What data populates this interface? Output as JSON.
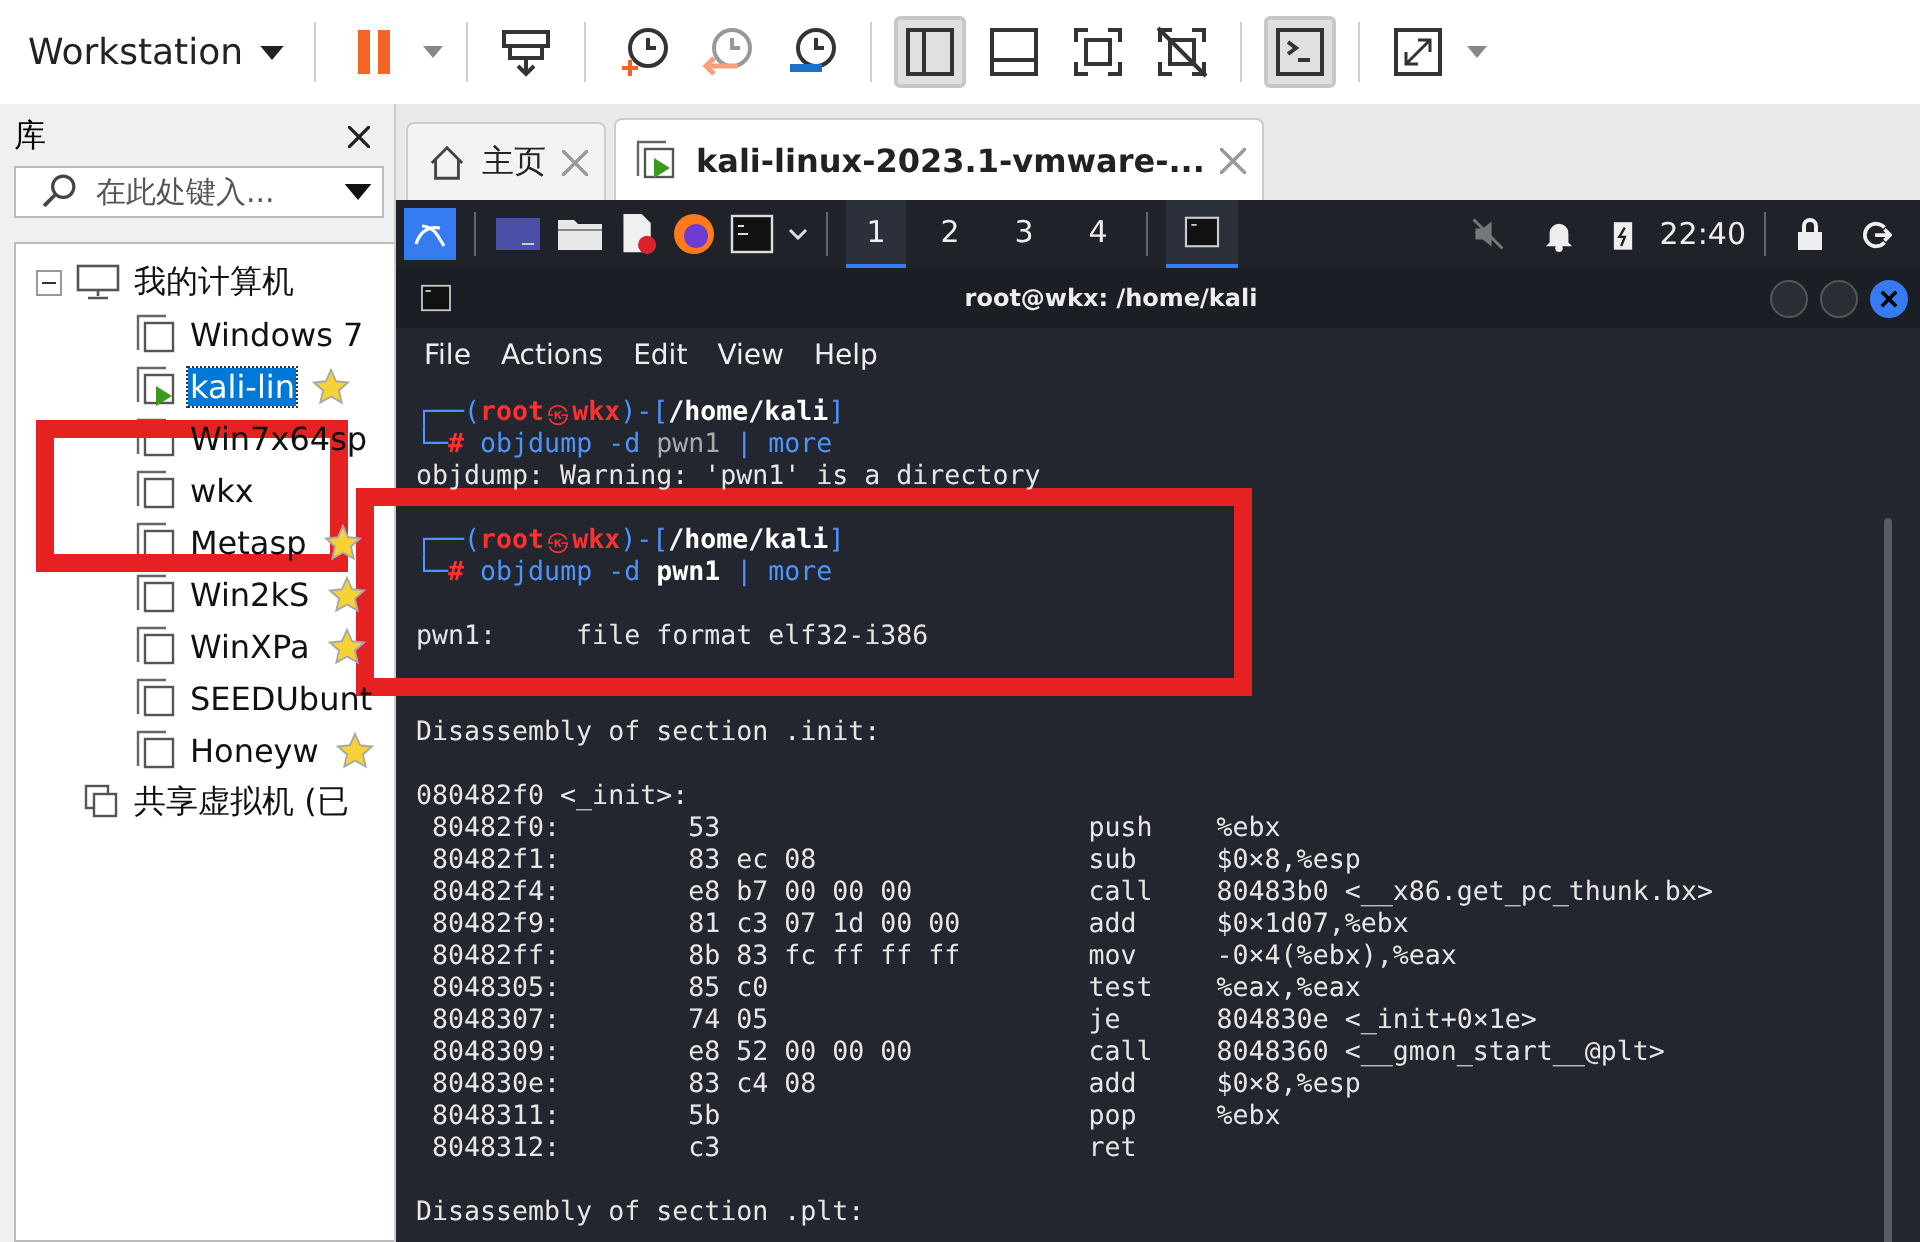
{
  "toolbar": {
    "menu_label": "Workstation",
    "buttons": [
      {
        "kind": "pause",
        "selected": false
      },
      {
        "kind": "send-keys",
        "selected": false
      },
      {
        "kind": "snapshot-take",
        "selected": false
      },
      {
        "kind": "snapshot-revert",
        "selected": false
      },
      {
        "kind": "snapshot-manager",
        "selected": false
      },
      {
        "kind": "view-sidebar",
        "selected": true
      },
      {
        "kind": "view-thumbnail",
        "selected": false
      },
      {
        "kind": "fullscreen",
        "selected": false
      },
      {
        "kind": "unity",
        "selected": false
      },
      {
        "kind": "console",
        "selected": true
      },
      {
        "kind": "stretch",
        "selected": false
      }
    ]
  },
  "library": {
    "title": "库",
    "search": {
      "placeholder": "在此处键入..."
    },
    "tree": [
      {
        "label": "我的计算机",
        "kind": "computer",
        "expanded": true,
        "children": [
          {
            "label": "Windows 7",
            "starred": false,
            "running": false,
            "selected": false
          },
          {
            "label": "kali-lin",
            "starred": true,
            "running": true,
            "selected": true
          },
          {
            "label": "Win7x64sp",
            "starred": false,
            "running": false,
            "selected": false
          },
          {
            "label": "wkx",
            "starred": false,
            "running": false,
            "selected": false
          },
          {
            "label": "Metasp",
            "starred": true,
            "running": false,
            "selected": false
          },
          {
            "label": "Win2kS",
            "starred": true,
            "running": false,
            "selected": false
          },
          {
            "label": "WinXPa",
            "starred": true,
            "running": false,
            "selected": false
          },
          {
            "label": "SEEDUbunt",
            "starred": false,
            "running": false,
            "selected": false
          },
          {
            "label": "Honeyw",
            "starred": true,
            "running": false,
            "selected": false
          }
        ]
      },
      {
        "label": "共享虚拟机 (已",
        "kind": "shared"
      }
    ]
  },
  "tabs": [
    {
      "label": "主页",
      "kind": "home",
      "selected": false
    },
    {
      "label": "kali-linux-2023.1-vmware-...",
      "kind": "vm",
      "selected": true
    }
  ],
  "kali_panel": {
    "workspaces": [
      {
        "label": "1",
        "selected": true
      },
      {
        "label": "2",
        "selected": false
      },
      {
        "label": "3",
        "selected": false
      },
      {
        "label": "4",
        "selected": false
      }
    ],
    "clock": "22:40"
  },
  "terminal": {
    "title": "root@wkx: /home/kali",
    "menu": [
      "File",
      "Actions",
      "Edit",
      "View",
      "Help"
    ],
    "lines": [
      {
        "kind": "prompt",
        "segments": [
          {
            "kind": "frame",
            "text": "┌──("
          },
          {
            "kind": "user",
            "text": "root"
          },
          {
            "kind": "symbol",
            "text": "㉿"
          },
          {
            "kind": "user",
            "text": "wkx"
          },
          {
            "kind": "frame",
            "text": ")-["
          },
          {
            "kind": "path",
            "text": "/home/kali"
          },
          {
            "kind": "frame",
            "text": "]"
          }
        ]
      },
      {
        "kind": "prompt",
        "segments": [
          {
            "kind": "frame",
            "text": "└─"
          },
          {
            "kind": "user",
            "text": "#"
          },
          {
            "kind": "cmd",
            "text": " objdump -d "
          },
          {
            "kind": "dim",
            "text": "pwn1"
          },
          {
            "kind": "cmd",
            "text": " | more"
          }
        ]
      },
      {
        "kind": "text",
        "text": "objdump: Warning: 'pwn1' is a directory"
      },
      {
        "kind": "blank"
      },
      {
        "kind": "prompt",
        "segments": [
          {
            "kind": "frame",
            "text": "┌──("
          },
          {
            "kind": "user",
            "text": "root"
          },
          {
            "kind": "symbol",
            "text": "㉿"
          },
          {
            "kind": "user",
            "text": "wkx"
          },
          {
            "kind": "frame",
            "text": ")-["
          },
          {
            "kind": "path",
            "text": "/home/kali"
          },
          {
            "kind": "frame",
            "text": "]"
          }
        ]
      },
      {
        "kind": "prompt",
        "segments": [
          {
            "kind": "frame",
            "text": "└─"
          },
          {
            "kind": "user",
            "text": "#"
          },
          {
            "kind": "cmd",
            "text": " objdump -d "
          },
          {
            "kind": "path",
            "text": "pwn1"
          },
          {
            "kind": "cmd",
            "text": " | more"
          }
        ]
      },
      {
        "kind": "blank"
      },
      {
        "kind": "text",
        "text": "pwn1:     file format elf32-i386"
      },
      {
        "kind": "blank"
      },
      {
        "kind": "blank"
      },
      {
        "kind": "text",
        "text": "Disassembly of section .init:"
      },
      {
        "kind": "blank"
      },
      {
        "kind": "text",
        "text": "080482f0 <_init>:"
      },
      {
        "kind": "asm",
        "addr": "80482f0:",
        "bytes": "53",
        "op": "push",
        "args": "%ebx"
      },
      {
        "kind": "asm",
        "addr": "80482f1:",
        "bytes": "83 ec 08",
        "op": "sub",
        "args": "$0×8,%esp"
      },
      {
        "kind": "asm",
        "addr": "80482f4:",
        "bytes": "e8 b7 00 00 00",
        "op": "call",
        "args": "80483b0 <__x86.get_pc_thunk.bx>"
      },
      {
        "kind": "asm",
        "addr": "80482f9:",
        "bytes": "81 c3 07 1d 00 00",
        "op": "add",
        "args": "$0×1d07,%ebx"
      },
      {
        "kind": "asm",
        "addr": "80482ff:",
        "bytes": "8b 83 fc ff ff ff",
        "op": "mov",
        "args": "-0×4(%ebx),%eax"
      },
      {
        "kind": "asm",
        "addr": "8048305:",
        "bytes": "85 c0",
        "op": "test",
        "args": "%eax,%eax"
      },
      {
        "kind": "asm",
        "addr": "8048307:",
        "bytes": "74 05",
        "op": "je",
        "args": "804830e <_init+0×1e>"
      },
      {
        "kind": "asm",
        "addr": "8048309:",
        "bytes": "e8 52 00 00 00",
        "op": "call",
        "args": "8048360 <__gmon_start__@plt>"
      },
      {
        "kind": "asm",
        "addr": "804830e:",
        "bytes": "83 c4 08",
        "op": "add",
        "args": "$0×8,%esp"
      },
      {
        "kind": "asm",
        "addr": "8048311:",
        "bytes": "5b",
        "op": "pop",
        "args": "%ebx"
      },
      {
        "kind": "asm",
        "addr": "8048312:",
        "bytes": "c3",
        "op": "ret"
      },
      {
        "kind": "blank"
      },
      {
        "kind": "text",
        "text": "Disassembly of section .plt:"
      }
    ]
  }
}
